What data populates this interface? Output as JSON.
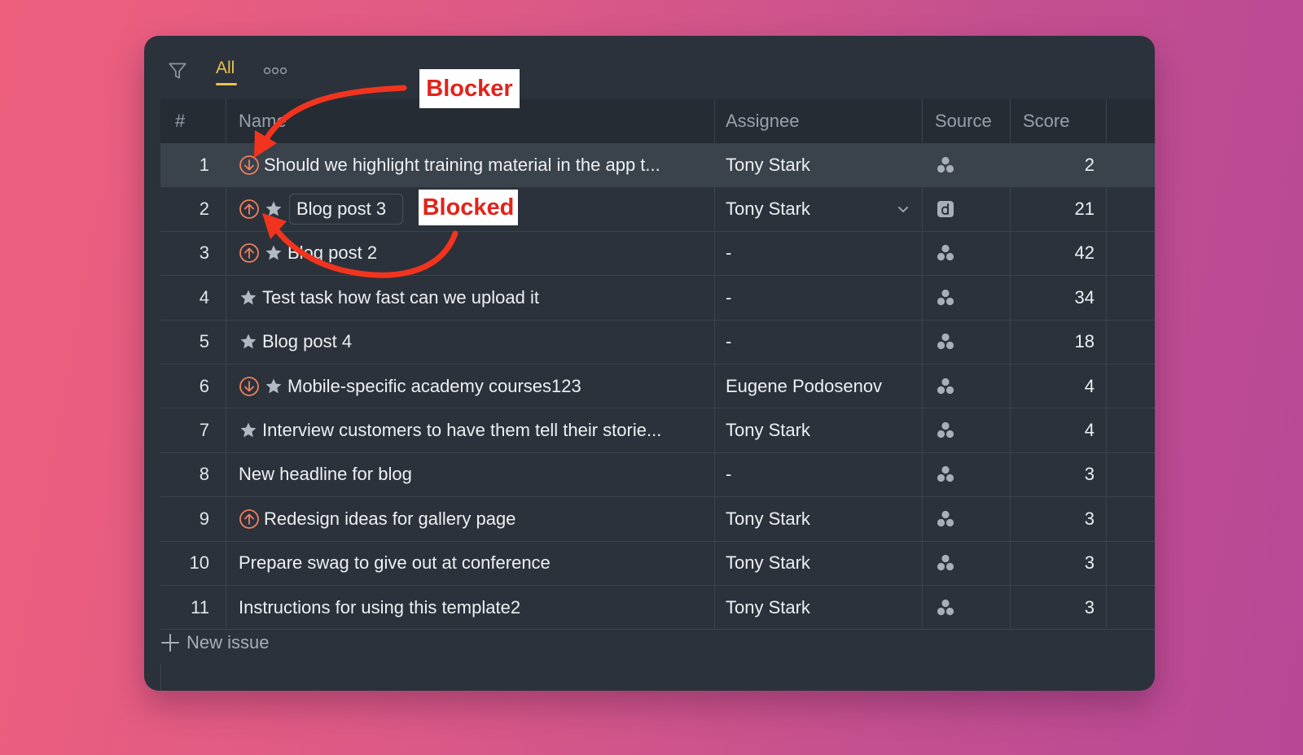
{
  "toolbar": {
    "filter_icon": "filter-icon",
    "view_tab": "All",
    "more_icon": "more-horizontal-icon"
  },
  "columns": {
    "num": "#",
    "name": "Name",
    "assignee": "Assignee",
    "source": "Source",
    "score": "Score"
  },
  "rows": [
    {
      "num": "1",
      "blocker": "down",
      "star": false,
      "name": "Should we highlight training material in the app t...",
      "assignee": "Tony Stark",
      "source": "cluster",
      "score": "2"
    },
    {
      "num": "2",
      "blocker": "up",
      "star": true,
      "name": "Blog post 3",
      "assignee": "Tony Stark",
      "source": "d-square",
      "score": "21"
    },
    {
      "num": "3",
      "blocker": "up",
      "star": true,
      "name": "Blog post 2",
      "assignee": "-",
      "source": "cluster",
      "score": "42"
    },
    {
      "num": "4",
      "blocker": "",
      "star": true,
      "name": "Test task how fast can we upload it",
      "assignee": "-",
      "source": "cluster",
      "score": "34"
    },
    {
      "num": "5",
      "blocker": "",
      "star": true,
      "name": "Blog post 4",
      "assignee": "-",
      "source": "cluster",
      "score": "18"
    },
    {
      "num": "6",
      "blocker": "down",
      "star": true,
      "name": "Mobile-specific academy courses123",
      "assignee": "Eugene Podosenov",
      "source": "cluster",
      "score": "4"
    },
    {
      "num": "7",
      "blocker": "",
      "star": true,
      "name": "Interview customers to have them tell their storie...",
      "assignee": "Tony Stark",
      "source": "cluster",
      "score": "4"
    },
    {
      "num": "8",
      "blocker": "",
      "star": false,
      "name": "New headline for blog",
      "assignee": "-",
      "source": "cluster",
      "score": "3"
    },
    {
      "num": "9",
      "blocker": "up",
      "star": false,
      "name": "Redesign ideas for gallery page",
      "assignee": "Tony Stark",
      "source": "cluster",
      "score": "3"
    },
    {
      "num": "10",
      "blocker": "",
      "star": false,
      "name": "Prepare swag to give out at conference",
      "assignee": "Tony Stark",
      "source": "cluster",
      "score": "3"
    },
    {
      "num": "11",
      "blocker": "",
      "star": false,
      "name": "Instructions for using this template2",
      "assignee": "Tony Stark",
      "source": "cluster",
      "score": "3"
    }
  ],
  "new_issue": "New issue",
  "annotations": {
    "blocker": "Blocker",
    "blocked": "Blocked"
  },
  "colors": {
    "accent": "#e9c34d",
    "blocker_icon": "#f08060",
    "callout_text": "#e2231a",
    "arrow": "#f2341f"
  }
}
